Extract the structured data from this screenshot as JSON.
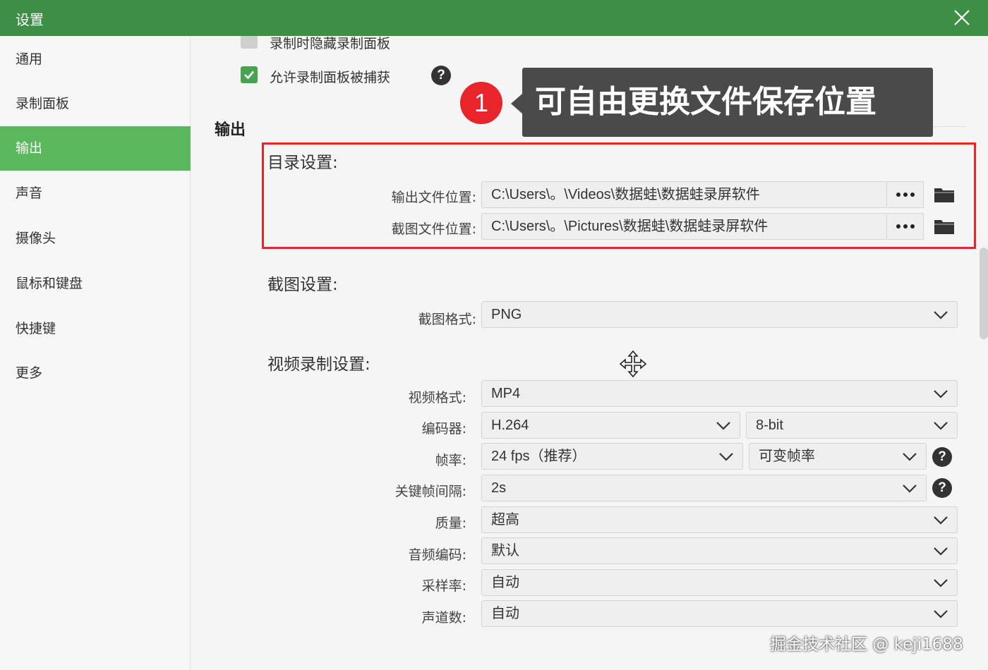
{
  "window": {
    "title": "设置"
  },
  "sidebar": {
    "items": [
      {
        "label": "通用"
      },
      {
        "label": "录制面板"
      },
      {
        "label": "输出"
      },
      {
        "label": "声音"
      },
      {
        "label": "摄像头"
      },
      {
        "label": "鼠标和键盘"
      },
      {
        "label": "快捷键"
      },
      {
        "label": "更多"
      }
    ],
    "active_index": 2
  },
  "checkboxes": {
    "hide_panel": {
      "label": "录制时隐藏录制面板",
      "checked": false
    },
    "allow_capture": {
      "label": "允许录制面板被捕获",
      "checked": true
    }
  },
  "section": {
    "title": "输出"
  },
  "annotation": {
    "number": "1",
    "text": "可自由更换文件保存位置"
  },
  "directory": {
    "title": "目录设置:",
    "output_label": "输出文件位置:",
    "output_path": "C:\\Users\\。\\Videos\\数据蛙\\数据蛙录屏软件",
    "screenshot_label": "截图文件位置:",
    "screenshot_path": "C:\\Users\\。\\Pictures\\数据蛙\\数据蛙录屏软件"
  },
  "screenshot_settings": {
    "title": "截图设置:",
    "format_label": "截图格式:",
    "format_value": "PNG"
  },
  "video_settings": {
    "title": "视频录制设置:",
    "format_label": "视频格式:",
    "format_value": "MP4",
    "encoder_label": "编码器:",
    "encoder_value": "H.264",
    "bitdepth_value": "8-bit",
    "framerate_label": "帧率:",
    "framerate_value": "24 fps（推荐）",
    "framerate_mode": "可变帧率",
    "keyframe_label": "关键帧间隔:",
    "keyframe_value": "2s",
    "quality_label": "质量:",
    "quality_value": "超高",
    "audio_codec_label": "音频编码:",
    "audio_codec_value": "默认",
    "sample_rate_label": "采样率:",
    "sample_rate_value": "自动",
    "channels_label": "声道数:",
    "channels_value": "自动"
  },
  "watermark": {
    "text": "掘金技术社区 @ keji1688"
  },
  "colors": {
    "titlebar": "#3d8f45",
    "active_nav": "#5cb85c",
    "highlight_frame": "#e02a2a",
    "callout_badge": "#e8252b",
    "callout_bg": "#4a4a4a"
  }
}
